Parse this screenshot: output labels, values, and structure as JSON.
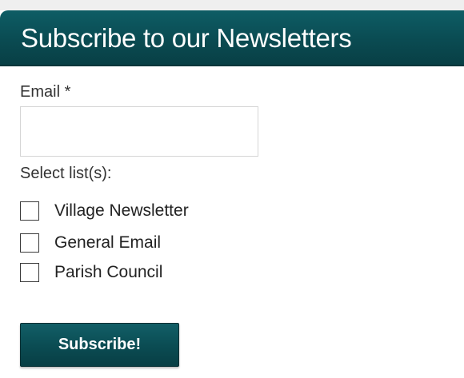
{
  "header": {
    "title": "Subscribe to our Newsletters"
  },
  "form": {
    "email_label": "Email *",
    "email_value": "",
    "email_placeholder": "",
    "lists_label": "Select list(s):",
    "lists": [
      {
        "label": "Village Newsletter",
        "checked": false
      },
      {
        "label": "General Email",
        "checked": false
      },
      {
        "label": "Parish Council",
        "checked": false
      }
    ],
    "submit_label": "Subscribe!"
  },
  "colors": {
    "header_bg": "#0a4b52",
    "button_bg": "#0b4d54",
    "text": "#333333"
  }
}
